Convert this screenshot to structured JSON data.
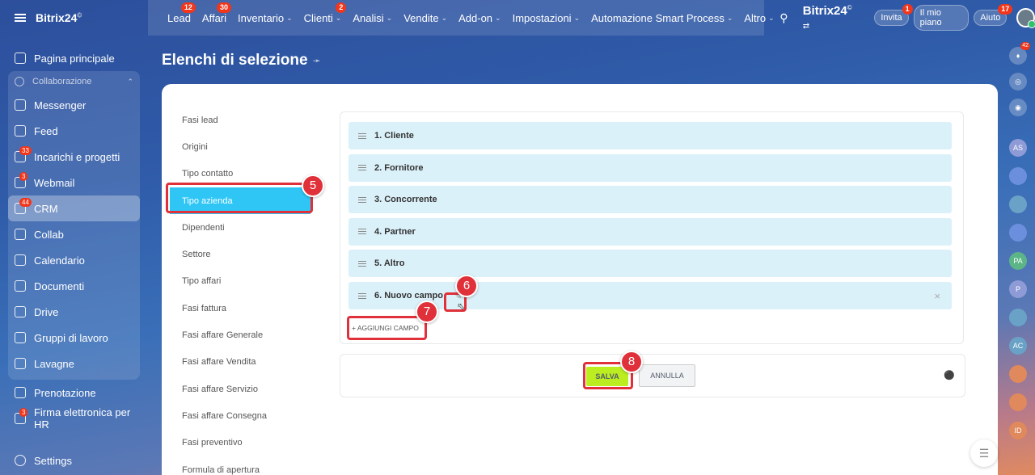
{
  "topbar": {
    "brand_small": "Bitrix24",
    "brand_small_mark": "©",
    "nav": [
      {
        "label": "Lead",
        "badge": "12",
        "chevron": false
      },
      {
        "label": "Affari",
        "badge": "30",
        "chevron": false
      },
      {
        "label": "Inventario",
        "badge": "",
        "chevron": true
      },
      {
        "label": "Clienti",
        "badge": "2",
        "chevron": true
      },
      {
        "label": "Analisi",
        "badge": "",
        "chevron": true
      },
      {
        "label": "Vendite",
        "badge": "",
        "chevron": true
      },
      {
        "label": "Add-on",
        "badge": "",
        "chevron": true
      },
      {
        "label": "Impostazioni",
        "badge": "",
        "chevron": true
      },
      {
        "label": "Automazione Smart Process",
        "badge": "",
        "chevron": true
      },
      {
        "label": "Altro",
        "badge": "",
        "chevron": true
      }
    ],
    "brand_big": "Bitrix24",
    "brand_big_mark": "©",
    "invite_label": "Invita",
    "invite_badge": "1",
    "plan_label": "Il mio piano",
    "help_label": "Aiuto",
    "help_badge": "17"
  },
  "sidebar": {
    "home": "Pagina principale",
    "collab_header": "Collaborazione",
    "collab_items": [
      {
        "label": "Messenger",
        "badge": ""
      },
      {
        "label": "Feed",
        "badge": ""
      },
      {
        "label": "Incarichi e progetti",
        "badge": "33"
      },
      {
        "label": "Webmail",
        "badge": "3"
      },
      {
        "label": "CRM",
        "badge": "44"
      },
      {
        "label": "Collab",
        "badge": ""
      },
      {
        "label": "Calendario",
        "badge": ""
      },
      {
        "label": "Documenti",
        "badge": ""
      },
      {
        "label": "Drive",
        "badge": ""
      },
      {
        "label": "Gruppi di lavoro",
        "badge": ""
      },
      {
        "label": "Lavagne",
        "badge": ""
      }
    ],
    "booking": "Prenotazione",
    "esign": "Firma elettronica per HR",
    "esign_badge": "3",
    "settings": "Settings"
  },
  "page": {
    "title": "Elenchi di selezione"
  },
  "lists": [
    "Fasi lead",
    "Origini",
    "Tipo contatto",
    "Tipo azienda",
    "Dipendenti",
    "Settore",
    "Tipo affari",
    "Fasi fattura",
    "Fasi affare Generale",
    "Fasi affare Vendita",
    "Fasi affare Servizio",
    "Fasi affare Consegna",
    "Fasi preventivo",
    "Formula di apertura"
  ],
  "fields": [
    "1. Cliente",
    "2. Fornitore",
    "3. Concorrente",
    "4. Partner",
    "5. Altro",
    "6. Nuovo campo"
  ],
  "add_field_label": "+ AGGIUNGI CAMPO",
  "buttons": {
    "save": "SALVA",
    "cancel": "ANNULLA"
  },
  "markers": {
    "m5": "5",
    "m6": "6",
    "m7": "7",
    "m8": "8"
  },
  "rail": {
    "notif_badge": "42",
    "items": [
      "AS",
      "",
      "",
      "",
      "PA",
      "P",
      "",
      "AC",
      "",
      "",
      "ID"
    ]
  },
  "colors": {
    "accent": "#2fc6f6",
    "save": "#bbed21",
    "callout": "#e0303a",
    "field_bg": "#dbf1f9"
  }
}
